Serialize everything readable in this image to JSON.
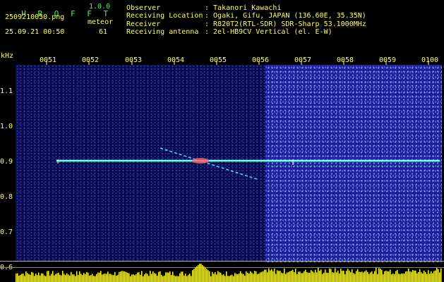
{
  "app": {
    "logo": "H R O F F T",
    "version": "1.0.0",
    "filename": "2509210050.png",
    "datetime": "25.09.21 00:50",
    "meteor_label": "meteor",
    "meteor_count": "61"
  },
  "info": [
    {
      "label": "Observer",
      "value": ": Takanori Kawachi"
    },
    {
      "label": "Receiving Location",
      "value": ": Ogaki, Gifu, JAPAN (136.60E, 35.35N)"
    },
    {
      "label": "Receiver",
      "value": ": R820T2(RTL-SDR) SDR-Sharp 53.1000MHz"
    },
    {
      "label": "Receiving antenna",
      "value": ": 2el-HB9CV Vertical (el. E-W)"
    }
  ],
  "axis": {
    "unit": "kHz",
    "x_ticks": [
      "0051",
      "0052",
      "0053",
      "0054",
      "0055",
      "0056",
      "0057",
      "0058",
      "0059",
      "0100"
    ],
    "y_ticks": [
      "1.1",
      "1.0",
      "0.9",
      "0.8",
      "0.7",
      "0.6"
    ]
  },
  "colors": {
    "label": "#ffff66",
    "logo": "#33ff55",
    "carrier": "#7fffe0",
    "spectrum": "#ffff00",
    "background": "#000000"
  }
}
